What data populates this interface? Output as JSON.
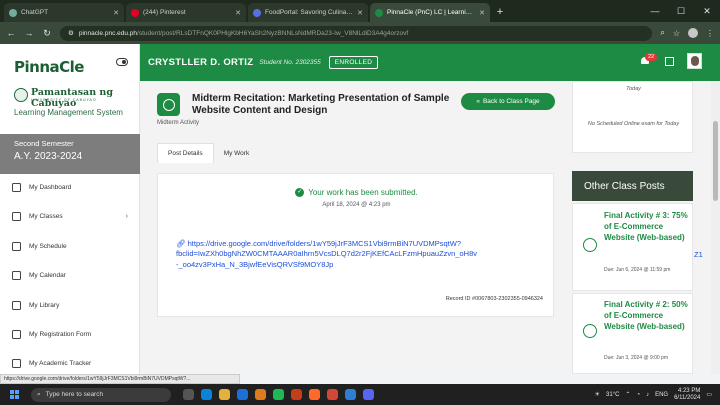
{
  "browser": {
    "tabs": [
      {
        "title": "ChatGPT",
        "color": "#74aa9c",
        "active": false
      },
      {
        "title": "(244) Pinterest",
        "color": "#e60023",
        "active": false
      },
      {
        "title": "FoodPortal: Savoring Culinary E",
        "color": "#5b6ee1",
        "active": false
      },
      {
        "title": "PinnaCle (PnC) LC | Learning M",
        "color": "#1e8b44",
        "active": true
      }
    ],
    "url_host": "pinnacle.pnc.edu.ph",
    "url_path": "/student/post/RLsDTFnQK0PHlgKbH6YaSh2NyzBNNLsNdMRDa23-Iw_V8NlLdiD3A4g4orzovf"
  },
  "sidebar": {
    "logo": "PinnaCle",
    "university": "Pamantasan ng Cabuyao",
    "university_sub": "UNIVERSITY OF CABUYAO",
    "lms_name": "Learning Management System",
    "semester": "Second Semester",
    "academic_year": "A.Y. 2023-2024",
    "menu": [
      {
        "label": "My Dashboard",
        "icon": "dashboard-icon"
      },
      {
        "label": "My Classes",
        "icon": "classes-icon",
        "has_chevron": true
      },
      {
        "label": "My Schedule",
        "icon": "schedule-icon"
      },
      {
        "label": "My Calendar",
        "icon": "calendar-icon"
      },
      {
        "label": "My Library",
        "icon": "library-icon"
      },
      {
        "label": "My Registration Form",
        "icon": "registration-icon"
      },
      {
        "label": "My Academic Tracker",
        "icon": "tracker-icon"
      }
    ]
  },
  "header": {
    "student_name": "CRYSTLLER D. ORTIZ",
    "student_no": "Student No. 2302355",
    "status": "ENROLLED",
    "notification_count": "22"
  },
  "page": {
    "title": "Midterm Recitation: Marketing Presentation of Sample Website Content and Design",
    "subtitle": "Midterm Activity",
    "back_label": "Back to Class Page",
    "tabs": [
      "Post Details",
      "My Work"
    ],
    "active_tab": "My Work",
    "submitted_text": "Your work has been submitted.",
    "submitted_date": "April 18, 2024 @ 4:23 pm",
    "link_line1": "https://drive.google.com/drive/folders/1wY59jJrF3MCS1Vbi9rmBiN7UVDMPsqtW?",
    "link_line2": "fbclid=IwZXh0bgNhZW0CMTAAAR0aIhrn5VcsDLQ7d2r2FjKEfCAcLFzmHpuauZzvn_oH8v",
    "link_line3": "-_oo4zv3PxHa_N_3BjwfEeVisQRVSf9MOY8Jp",
    "link_overflow": "Z1",
    "record_id": "Record ID #0067803-2302355-0946324"
  },
  "right": {
    "top_text1": "Today",
    "top_text2": "No Scheduled Online exam for Today",
    "other_posts_title": "Other Class Posts",
    "posts": [
      {
        "title": "Final Activity # 3: 75% of E-Commerce Website (Web-based)",
        "due": "Due: Jun 6, 2024 @ 11:59 pm"
      },
      {
        "title": "Final Activity # 2: 50% of E-Commerce Website (Web-based)",
        "due": "Due: Jun 3, 2024 @ 9:00 pm"
      }
    ]
  },
  "status_bar_url": "https://drive.google.com/drive/folders/1wY59jJrF3MCS1Vbi9rmBiN7UVDMPsqtW?...",
  "taskbar": {
    "search_placeholder": "Type here to search",
    "temperature": "31°C",
    "language": "ENG",
    "time": "4:23 PM",
    "date": "6/11/2024"
  },
  "colors": {
    "primary": "#1e8b44",
    "dark": "#3a4a3a",
    "link": "#1d4ed8"
  }
}
